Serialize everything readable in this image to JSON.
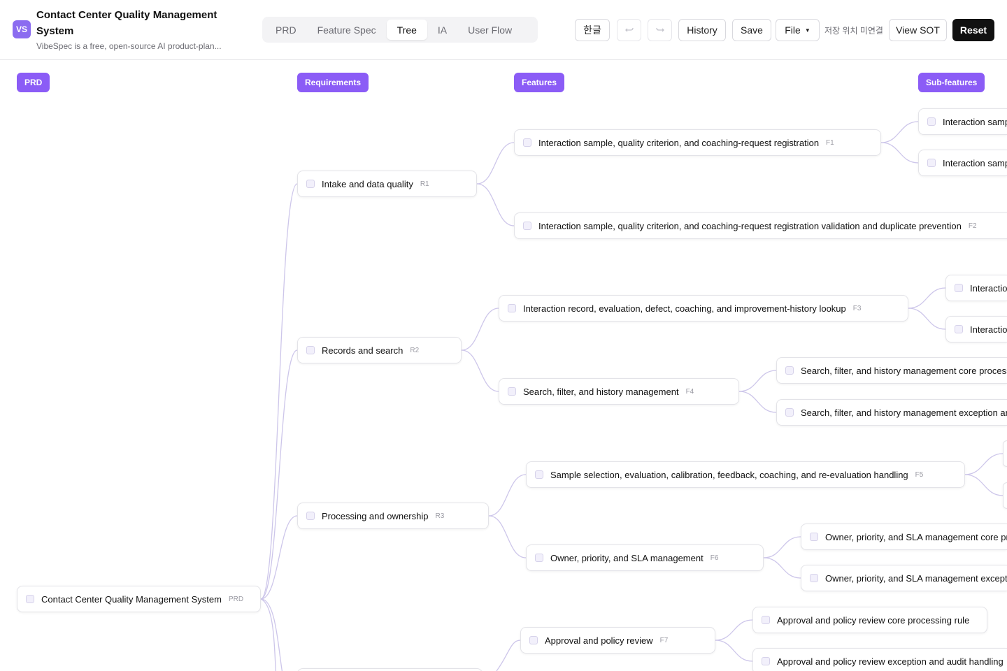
{
  "app": {
    "logo": "VS",
    "title": "Contact Center Quality Management System",
    "subtitle": "VibeSpec is a free, open-source AI product-plan..."
  },
  "tabs": [
    {
      "label": "PRD",
      "active": false
    },
    {
      "label": "Feature Spec",
      "active": false
    },
    {
      "label": "Tree",
      "active": true
    },
    {
      "label": "IA",
      "active": false
    },
    {
      "label": "User Flow",
      "active": false
    }
  ],
  "toolbar": {
    "language_label": "한글",
    "undo_icon": "undo-icon",
    "redo_icon": "redo-icon",
    "history_label": "History",
    "save_label": "Save",
    "file_label": "File",
    "save_status": "저장 위치 미연결",
    "view_sot_label": "View SOT",
    "reset_label": "Reset"
  },
  "columns": [
    "PRD",
    "Requirements",
    "Features",
    "Sub-features"
  ],
  "tree": {
    "root": {
      "label": "Contact Center Quality Management System",
      "id": "PRD"
    },
    "requirements": [
      {
        "label": "Intake and data quality",
        "id": "R1"
      },
      {
        "label": "Records and search",
        "id": "R2"
      },
      {
        "label": "Processing and ownership",
        "id": "R3"
      },
      {
        "label": "",
        "id": ""
      }
    ],
    "features": [
      {
        "label": "Interaction sample, quality criterion, and coaching-request registration",
        "id": "F1"
      },
      {
        "label": "Interaction sample, quality criterion, and coaching-request registration validation and duplicate prevention",
        "id": "F2"
      },
      {
        "label": "Interaction record, evaluation, defect, coaching, and improvement-history lookup",
        "id": "F3"
      },
      {
        "label": "Search, filter, and history management",
        "id": "F4"
      },
      {
        "label": "Sample selection, evaluation, calibration, feedback, coaching, and re-evaluation handling",
        "id": "F5"
      },
      {
        "label": "Owner, priority, and SLA management",
        "id": "F6"
      },
      {
        "label": "Approval and policy review",
        "id": "F7"
      }
    ],
    "subfeatures": [
      {
        "label": "Interaction samp"
      },
      {
        "label": "Interaction samp"
      },
      {
        "label": "Interactio"
      },
      {
        "label": "Interactio"
      },
      {
        "label": "Search, filter, and history management core processi"
      },
      {
        "label": "Search, filter, and history management exception an"
      },
      {
        "label": ""
      },
      {
        "label": ""
      },
      {
        "label": "Owner, priority, and SLA management core pr"
      },
      {
        "label": "Owner, priority, and SLA management excepti"
      },
      {
        "label": "Approval and policy review core processing rule"
      },
      {
        "label": "Approval and policy review exception and audit handling"
      }
    ]
  }
}
